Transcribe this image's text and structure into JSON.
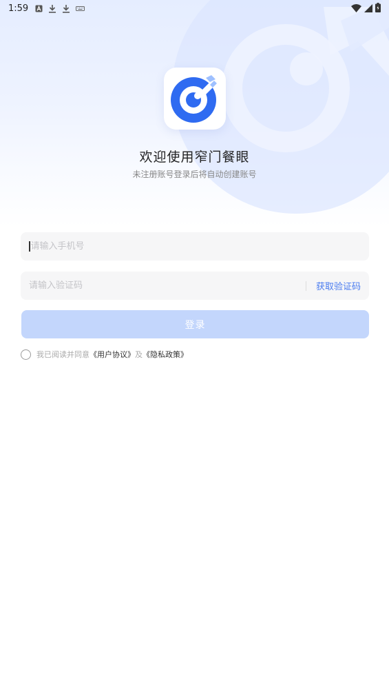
{
  "status_bar": {
    "time": "1:59",
    "left_icons": [
      "a-notification-icon",
      "download-icon",
      "download-icon",
      "keyboard-icon"
    ],
    "right_icons": [
      "wifi-icon",
      "signal-icon",
      "battery-icon"
    ]
  },
  "app": {
    "title": "欢迎使用窄门餐眼",
    "subtitle": "未注册账号登录后将自动创建账号",
    "logo_icon": "app-logo-icon",
    "brand_color": "#2f6bf1"
  },
  "form": {
    "phone_placeholder": "请输入手机号",
    "code_placeholder": "请输入验证码",
    "get_code_label": "获取验证码",
    "login_label": "登录"
  },
  "agreement": {
    "prefix": "我已阅读并同意",
    "user_agreement": "《用户协议》",
    "joiner": "及",
    "privacy_policy": "《隐私政策》"
  },
  "colors": {
    "accent": "#4a7cf0",
    "button_disabled": "#c3d6fc",
    "background_top": "#e5edff"
  }
}
